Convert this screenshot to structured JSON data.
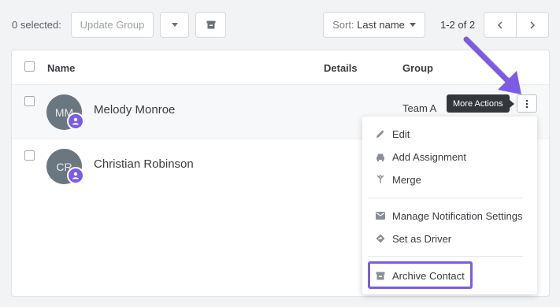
{
  "toolbar": {
    "selected_count": "0 selected:",
    "update_group_label": "Update Group",
    "sort_prefix": "Sort:",
    "sort_value": "Last name",
    "pagination": "1-2 of 2"
  },
  "table": {
    "columns": [
      "Name",
      "Details",
      "Group"
    ],
    "rows": [
      {
        "initials": "MM",
        "name": "Melody Monroe",
        "group": "Team A"
      },
      {
        "initials": "CR",
        "name": "Christian Robinson",
        "group": ""
      }
    ]
  },
  "tooltip": {
    "text": "More Actions"
  },
  "menu": {
    "items": [
      {
        "label": "Edit",
        "icon": "pencil-icon"
      },
      {
        "label": "Add Assignment",
        "icon": "car-icon"
      },
      {
        "label": "Merge",
        "icon": "merge-icon"
      },
      {
        "label": "Manage Notification Settings",
        "icon": "mail-icon"
      },
      {
        "label": "Set as Driver",
        "icon": "direction-icon"
      },
      {
        "label": "Archive Contact",
        "icon": "archive-icon"
      }
    ]
  },
  "colors": {
    "accent": "#7c5ce4",
    "avatar": "#6b7780",
    "tooltip_bg": "#33363b"
  }
}
